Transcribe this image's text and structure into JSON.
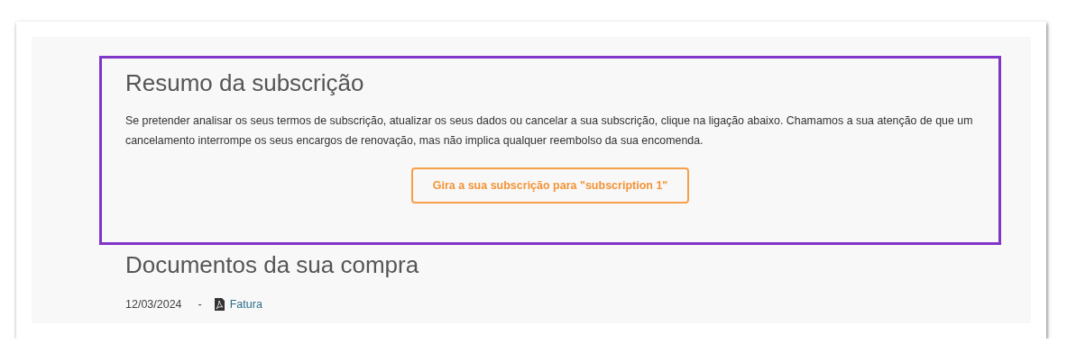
{
  "subscription_summary": {
    "title": "Resumo da subscrição",
    "description": "Se pretender analisar os seus termos de subscrição, atualizar os seus dados ou cancelar a sua subscrição, clique na ligação abaixo. Chamamos a sua atenção de que um cancelamento interrompe os seus encargos de renovação, mas não implica qualquer reembolso da sua encomenda.",
    "button": "Gira a sua subscrição para \"subscription 1\""
  },
  "documents": {
    "title": "Documentos da sua compra",
    "items": [
      {
        "date": "12/03/2024",
        "separator": "-",
        "kind": "pdf",
        "link": "Fatura"
      }
    ]
  }
}
